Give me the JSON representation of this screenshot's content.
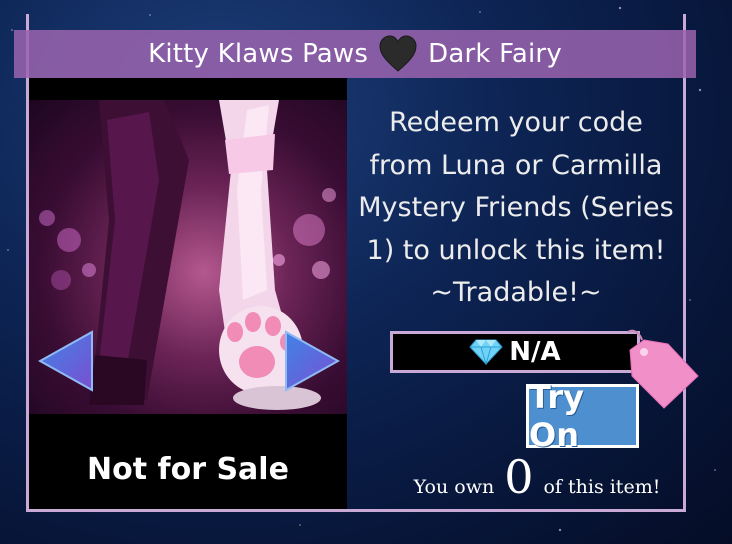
{
  "title": {
    "left": "Kitty Klaws Paws",
    "right": "Dark Fairy",
    "separator_icon": "heart-icon"
  },
  "item": {
    "description": "Redeem your code from Luna or Carmilla Mystery Friends (Series 1) to unlock this item! ~Tradable!~",
    "sale_status": "Not for Sale",
    "price": "N/A",
    "price_icon": "diamond-icon",
    "tag_icon": "price-tag-icon"
  },
  "actions": {
    "try_on_label": "Try On"
  },
  "ownership": {
    "prefix": "You own",
    "count": "0",
    "suffix": "of this item!"
  },
  "colors": {
    "title_bar": "#9b64af",
    "frame": "#c9a9d6",
    "try_on": "#4e8fd0",
    "tag": "#f08fc8"
  }
}
